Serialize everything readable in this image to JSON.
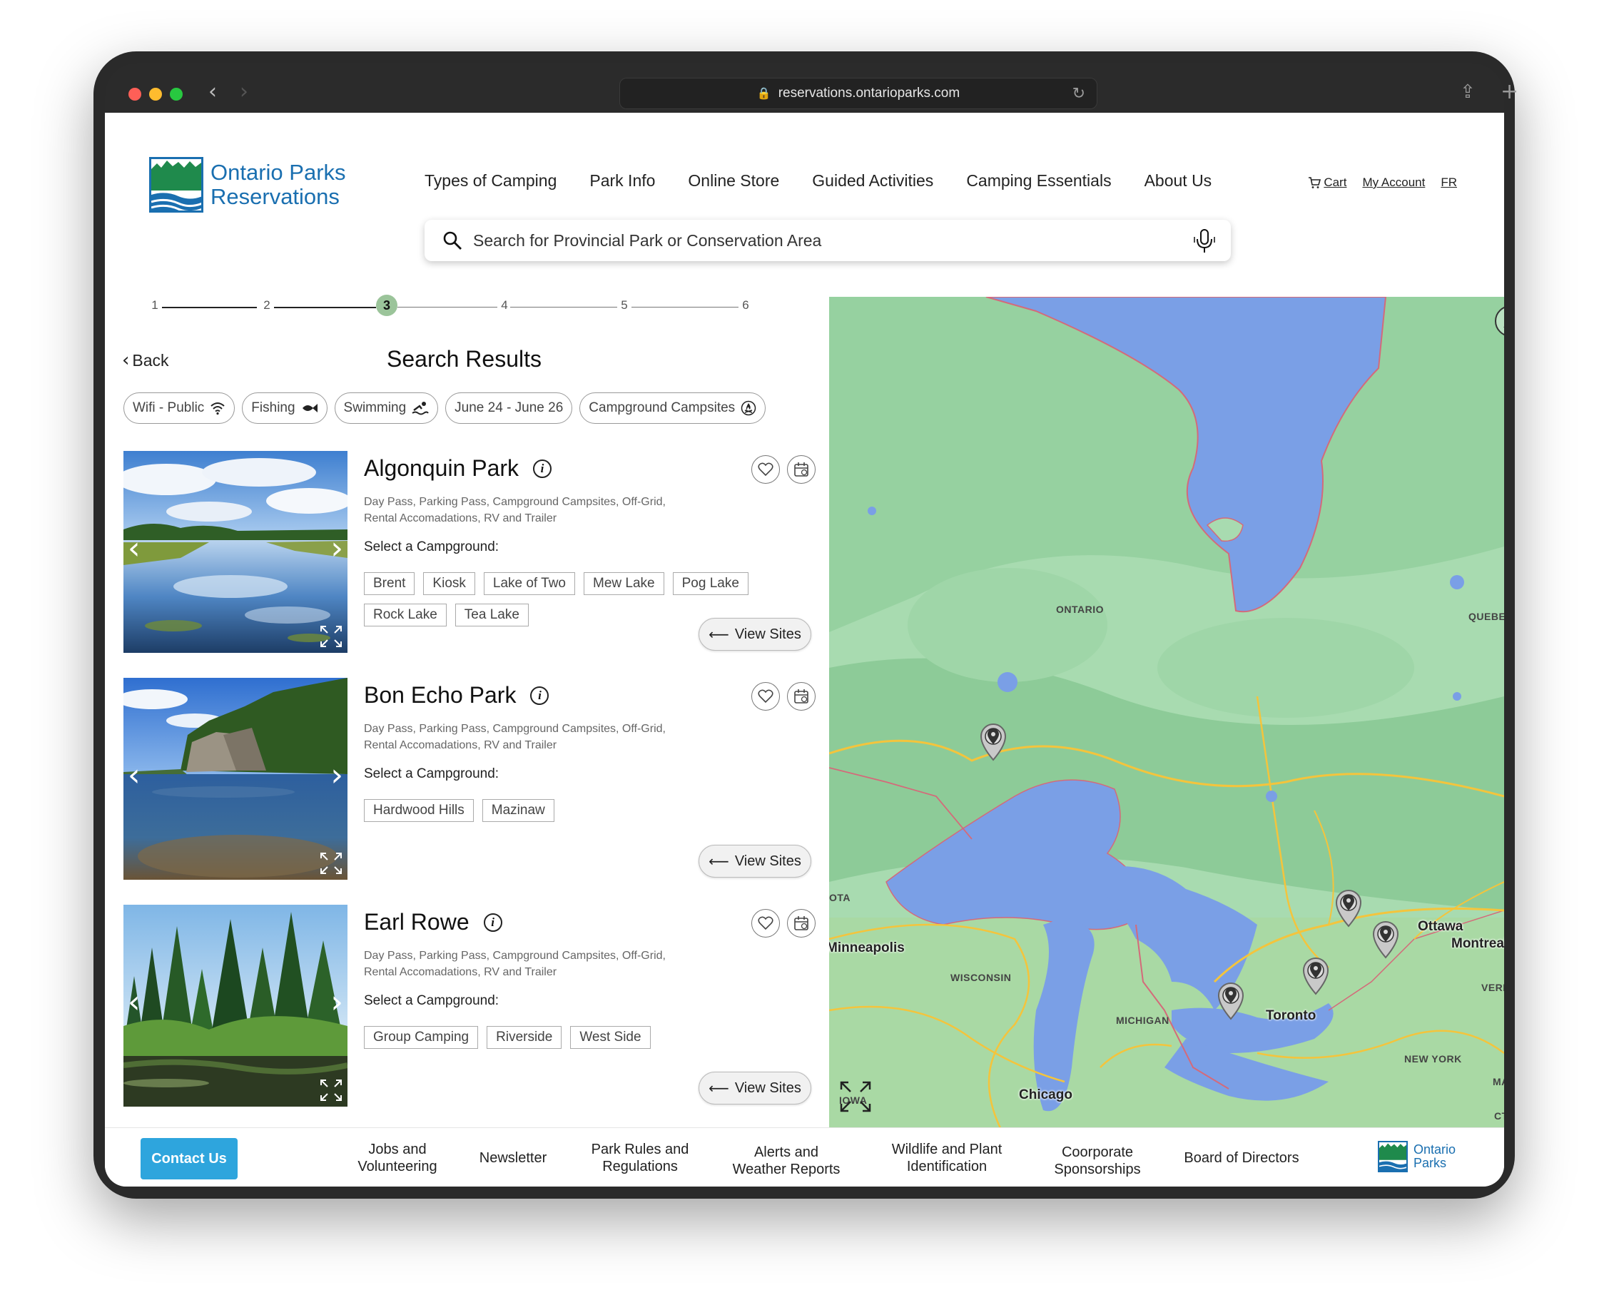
{
  "browser": {
    "url": "reservations.ontarioparks.com"
  },
  "logo": {
    "line1": "Ontario Parks",
    "line2": "Reservations"
  },
  "nav": {
    "items": [
      "Types of Camping",
      "Park Info",
      "Online Store",
      "Guided Activities",
      "Camping Essentials",
      "About Us"
    ]
  },
  "account": {
    "cart": "Cart",
    "my_account": "My Account",
    "lang": "FR"
  },
  "search": {
    "placeholder": "Search for Provincial Park or Conservation Area"
  },
  "stepper": {
    "steps": [
      "1",
      "2",
      "3",
      "4",
      "5",
      "6"
    ],
    "current": 3
  },
  "results": {
    "back_label": "Back",
    "title": "Search Results"
  },
  "filters": [
    {
      "label": "Wifi - Public",
      "icon": "wifi-icon"
    },
    {
      "label": "Fishing",
      "icon": "fish-icon"
    },
    {
      "label": "Swimming",
      "icon": "swimmer-icon"
    },
    {
      "label": "June 24 - June 26",
      "icon": ""
    },
    {
      "label": "Campground Campsites",
      "icon": "campfire-icon"
    }
  ],
  "parks": [
    {
      "name": "Algonquin Park",
      "desc_line1": "Day Pass, Parking Pass, Campground Campsites, Off-Grid,",
      "desc_line2": "Rental Accomadations, RV and Trailer",
      "select_label": "Select a Campground:",
      "campgrounds": [
        "Brent",
        "Kiosk",
        "Lake of Two",
        "Mew Lake",
        "Pog Lake",
        "Rock Lake",
        "Tea Lake"
      ],
      "view_label": "View Sites"
    },
    {
      "name": "Bon Echo Park",
      "desc_line1": "Day Pass, Parking Pass, Campground Campsites, Off-Grid,",
      "desc_line2": "Rental Accomadations, RV and Trailer",
      "select_label": "Select a Campground:",
      "campgrounds": [
        "Hardwood Hills",
        "Mazinaw"
      ],
      "view_label": "View Sites"
    },
    {
      "name": "Earl Rowe",
      "desc_line1": "Day Pass, Parking Pass, Campground Campsites, Off-Grid,",
      "desc_line2": "Rental Accomadations, RV and Trailer",
      "select_label": "Select a Campground:",
      "campgrounds": [
        "Group Camping",
        "Riverside",
        "West Side"
      ],
      "view_label": "View Sites"
    }
  ],
  "map": {
    "regions": {
      "ontario": "ONTARIO",
      "quebec": "QUEBEC",
      "wisconsin": "WISCONSIN",
      "michigan": "MICHIGAN",
      "new_york": "NEW YORK",
      "iowa": "IOWA",
      "dakota": "OTA",
      "vermont": "VERM",
      "ma": "MA",
      "ct": "CT"
    },
    "cities": {
      "minneapolis": "Minneapolis",
      "chicago": "Chicago",
      "toronto": "Toronto",
      "ottawa": "Ottawa",
      "montreal": "Montreal"
    },
    "colors": {
      "land": "#9fd6a6",
      "water": "#7a9fe6",
      "forest": "#8acb95",
      "roads": "#f4c43c"
    }
  },
  "footer": {
    "contact": "Contact Us",
    "links": [
      {
        "line1": "Jobs and",
        "line2": "Volunteering"
      },
      {
        "line1": "Newsletter",
        "line2": ""
      },
      {
        "line1": "Park Rules and",
        "line2": "Regulations"
      },
      {
        "line1": "Alerts and",
        "line2": "Weather Reports"
      },
      {
        "line1": "Wildlife and Plant",
        "line2": "Identification"
      },
      {
        "line1": "Coorporate",
        "line2": "Sponsorships"
      },
      {
        "line1": "Board of Directors",
        "line2": ""
      }
    ],
    "logo_line1": "Ontario",
    "logo_line2": "Parks"
  }
}
